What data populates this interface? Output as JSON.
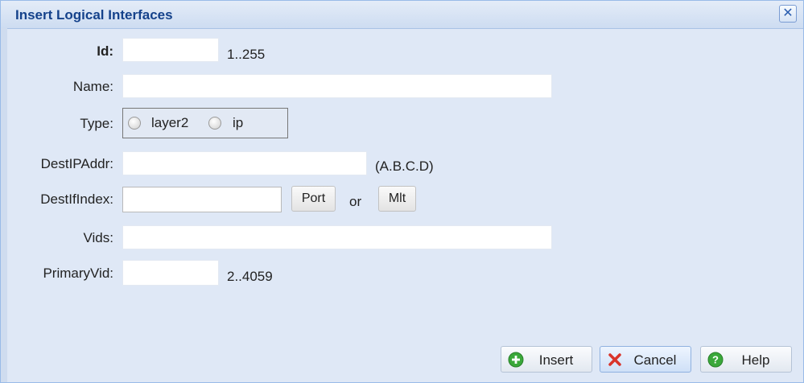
{
  "dialog": {
    "title": "Insert Logical Interfaces",
    "close_label": "✕"
  },
  "form": {
    "id": {
      "label": "Id:",
      "value": "",
      "hint": "1..255"
    },
    "name": {
      "label": "Name:",
      "value": ""
    },
    "type": {
      "label": "Type:",
      "options": [
        {
          "label": "layer2",
          "selected": false
        },
        {
          "label": "ip",
          "selected": false
        }
      ]
    },
    "dest_ip_addr": {
      "label": "DestIPAddr:",
      "value": "",
      "hint": "(A.B.C.D)"
    },
    "dest_if_index": {
      "label": "DestIfIndex:",
      "value": "",
      "port_label": "Port",
      "or_label": "or",
      "mlt_label": "Mlt"
    },
    "vids": {
      "label": "Vids:",
      "value": ""
    },
    "primary_vid": {
      "label": "PrimaryVid:",
      "value": "",
      "hint": "2..4059"
    }
  },
  "footer": {
    "insert_label": "Insert",
    "cancel_label": "Cancel",
    "help_label": "Help"
  },
  "colors": {
    "title": "#15428b",
    "insert_icon": "#3aa83a",
    "cancel_icon": "#d9342b",
    "help_icon": "#3aa83a"
  }
}
